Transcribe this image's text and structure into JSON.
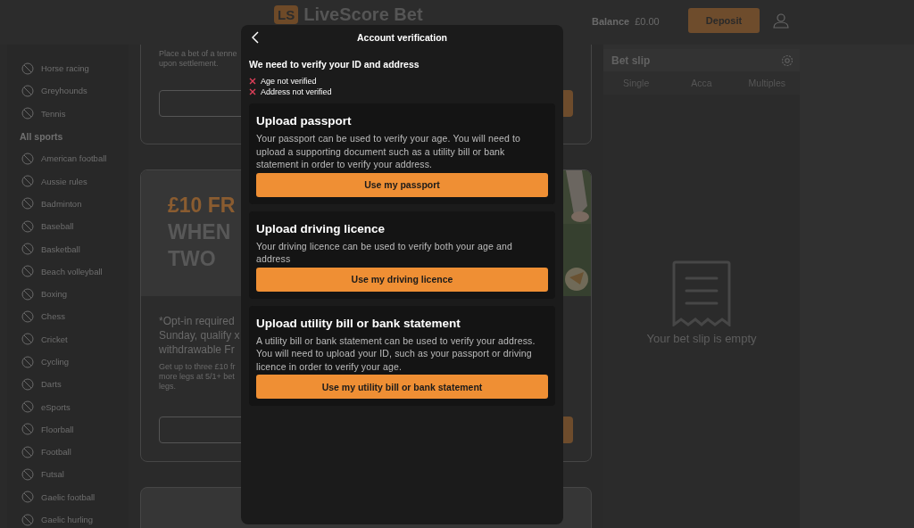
{
  "header": {
    "logo_badge": "LS",
    "logo": "LiveScore Bet",
    "balance_label": "Balance",
    "balance": "£0.00",
    "deposit": "Deposit"
  },
  "sidebar": {
    "items": [
      {
        "kind": "sport",
        "label": "Horse racing"
      },
      {
        "kind": "sport",
        "label": "Greyhounds"
      },
      {
        "kind": "sport",
        "label": "Tennis"
      },
      {
        "kind": "heading",
        "label": "All sports"
      },
      {
        "kind": "sport",
        "label": "American football"
      },
      {
        "kind": "sport",
        "label": "Aussie rules"
      },
      {
        "kind": "sport",
        "label": "Badminton"
      },
      {
        "kind": "sport",
        "label": "Baseball"
      },
      {
        "kind": "sport",
        "label": "Basketball"
      },
      {
        "kind": "sport",
        "label": "Beach volleyball"
      },
      {
        "kind": "sport",
        "label": "Boxing"
      },
      {
        "kind": "sport",
        "label": "Chess"
      },
      {
        "kind": "sport",
        "label": "Cricket"
      },
      {
        "kind": "sport",
        "label": "Cycling"
      },
      {
        "kind": "sport",
        "label": "Darts"
      },
      {
        "kind": "sport",
        "label": "eSports"
      },
      {
        "kind": "sport",
        "label": "Floorball"
      },
      {
        "kind": "sport",
        "label": "Football"
      },
      {
        "kind": "sport",
        "label": "Futsal"
      },
      {
        "kind": "sport",
        "label": "Gaelic football"
      },
      {
        "kind": "sport",
        "label": "Gaelic hurling"
      }
    ]
  },
  "promos": [
    {
      "body": [
        "Place a bet of a tenne",
        "upon settlement."
      ]
    },
    {
      "banner": [
        "£10 FR",
        "WHEN",
        "TWO"
      ],
      "lead": [
        "*Opt-in required",
        "Sunday, qualify x",
        "withdrawable Fr"
      ],
      "body": [
        "Get up to three £10 fr",
        "more legs at 5/1+ bet",
        "legs."
      ]
    }
  ],
  "bet_slip": {
    "title": "Bet slip",
    "tabs": [
      {
        "label": "Single",
        "selected": false
      },
      {
        "label": "Acca",
        "selected": false
      },
      {
        "label": "Multiples",
        "selected": false
      }
    ],
    "empty_message": "Your bet slip is empty"
  },
  "modal": {
    "title": "Account verification",
    "heading": "We need to verify your ID and address",
    "checks": [
      {
        "label": "Age not verified",
        "verified": false
      },
      {
        "label": "Address not verified",
        "verified": false
      }
    ],
    "options": [
      {
        "title": "Upload passport",
        "body": "Your passport can be used to verify your age. You will need to upload a supporting document such as a utility bill or bank statement in order to verify your address.",
        "button": "Use my passport"
      },
      {
        "title": "Upload driving licence",
        "body": "Your driving licence can be used to verify both your age and address",
        "button": "Use my driving licence"
      },
      {
        "title": "Upload utility bill or bank statement",
        "body": "A utility bill or bank statement can be used to verify your address. You will need to upload your ID, such as your passport or driving licence in order to verify your age.",
        "button": "Use my utility bill or bank statement"
      }
    ]
  }
}
